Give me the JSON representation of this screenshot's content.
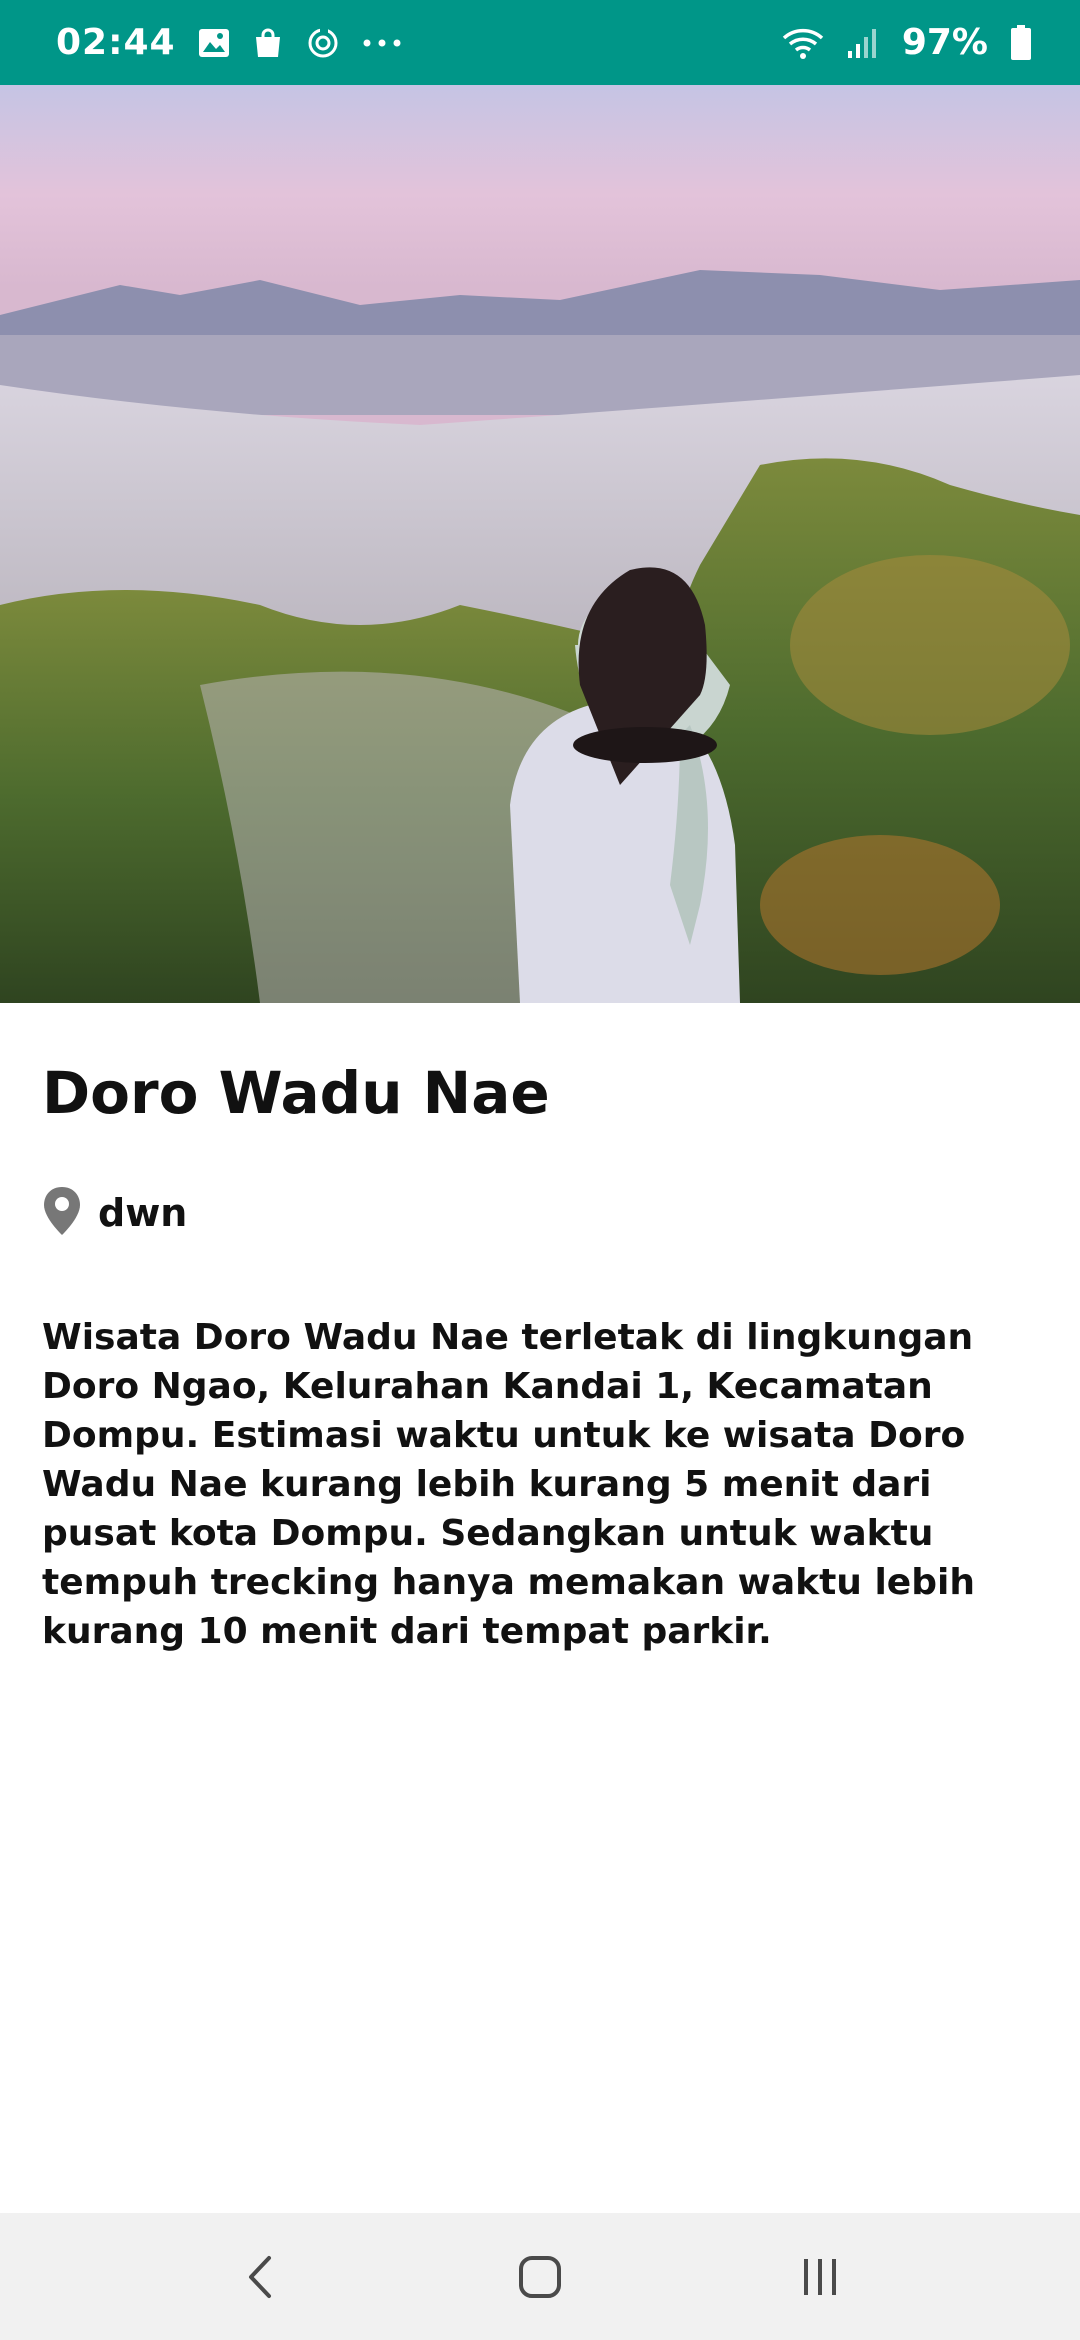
{
  "status_bar": {
    "time": "02:44",
    "battery": "97%",
    "left_icons": [
      "gallery-icon",
      "shopping-bag-icon",
      "sync-icon",
      "more-dots-icon"
    ],
    "right_icons": [
      "wifi-icon",
      "signal-icon",
      "battery-icon"
    ]
  },
  "hero": {
    "description": "hero-image"
  },
  "place": {
    "title": "Doro Wadu Nae",
    "location": "dwn",
    "description": "Wisata Doro Wadu Nae terletak di lingkungan Doro Ngao, Kelurahan Kandai 1, Kecamatan Dompu. Estimasi waktu untuk ke wisata Doro Wadu Nae kurang lebih kurang 5 menit dari pusat kota Dompu. Sedangkan untuk waktu tempuh trecking hanya memakan waktu lebih kurang 10 menit dari tempat parkir."
  },
  "nav": {
    "buttons": [
      "back-icon",
      "home-icon",
      "recents-icon"
    ]
  },
  "colors": {
    "status_bar": "#009688",
    "text": "#111111",
    "nav_bar": "#f1f1f1",
    "pin": "#777777"
  }
}
